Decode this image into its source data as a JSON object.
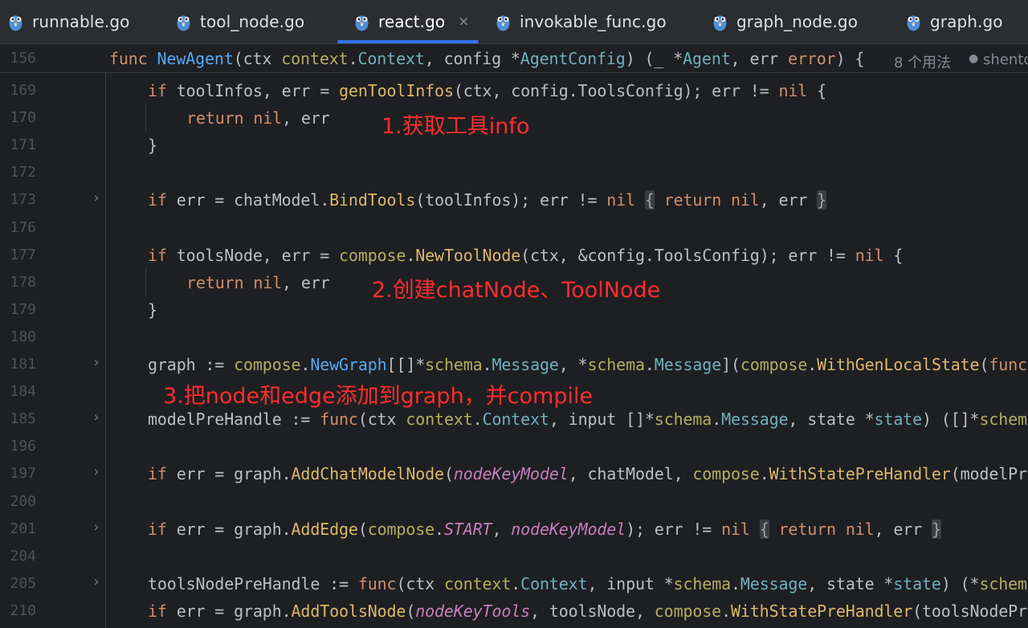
{
  "tabs": [
    {
      "label": "runnable.go",
      "icon": "gopher-icon",
      "active": false
    },
    {
      "label": "tool_node.go",
      "icon": "gopher-icon",
      "active": false
    },
    {
      "label": "react.go",
      "icon": "gopher-icon",
      "active": true,
      "close": "×"
    },
    {
      "label": "invokable_func.go",
      "icon": "gopher-icon",
      "active": false
    },
    {
      "label": "graph_node.go",
      "icon": "gopher-icon",
      "active": false
    },
    {
      "label": "graph.go",
      "icon": "gopher-icon",
      "active": false
    }
  ],
  "sticky": {
    "line_number": "156",
    "tokens": [
      {
        "t": "func ",
        "c": "kw"
      },
      {
        "t": "NewAgent",
        "c": "fn"
      },
      {
        "t": "(ctx ",
        "c": "id"
      },
      {
        "t": "context",
        "c": "pkg"
      },
      {
        "t": ".",
        "c": "id"
      },
      {
        "t": "Context",
        "c": "typ"
      },
      {
        "t": ", config *",
        "c": "id"
      },
      {
        "t": "AgentConfig",
        "c": "typ"
      },
      {
        "t": ") (_ *",
        "c": "id"
      },
      {
        "t": "Agent",
        "c": "typ"
      },
      {
        "t": ", err ",
        "c": "id"
      },
      {
        "t": "error",
        "c": "kw"
      },
      {
        "t": ") {",
        "c": "id"
      }
    ],
    "usages_hint": "8 个用法",
    "author_hint": "shentong"
  },
  "lines": [
    {
      "num": "169",
      "fold": false,
      "indent": 1,
      "tokens": [
        {
          "t": "if ",
          "c": "kw"
        },
        {
          "t": "toolInfos, err = ",
          "c": "id"
        },
        {
          "t": "genToolInfos",
          "c": "fc"
        },
        {
          "t": "(ctx, config.ToolsConfig); err != ",
          "c": "id"
        },
        {
          "t": "nil",
          "c": "kw"
        },
        {
          "t": " {",
          "c": "id"
        }
      ]
    },
    {
      "num": "170",
      "fold": false,
      "indent": 2,
      "tokens": [
        {
          "t": "return ",
          "c": "kw"
        },
        {
          "t": "nil",
          "c": "kw"
        },
        {
          "t": ", err",
          "c": "id"
        }
      ]
    },
    {
      "num": "171",
      "fold": false,
      "indent": 1,
      "tokens": [
        {
          "t": "}",
          "c": "id"
        }
      ]
    },
    {
      "num": "172",
      "fold": false,
      "indent": 1,
      "tokens": []
    },
    {
      "num": "173",
      "fold": true,
      "indent": 1,
      "tokens": [
        {
          "t": "if ",
          "c": "kw"
        },
        {
          "t": "err = chatModel.",
          "c": "id"
        },
        {
          "t": "BindTools",
          "c": "fc"
        },
        {
          "t": "(toolInfos); err != ",
          "c": "id"
        },
        {
          "t": "nil",
          "c": "kw"
        },
        {
          "t": " ",
          "c": "id"
        },
        {
          "t": "{",
          "c": "box"
        },
        {
          "t": " ",
          "c": "id"
        },
        {
          "t": "return ",
          "c": "kw"
        },
        {
          "t": "nil",
          "c": "kw"
        },
        {
          "t": ", err",
          "c": "id"
        },
        {
          "t": " ",
          "c": "id"
        },
        {
          "t": "}",
          "c": "box"
        }
      ]
    },
    {
      "num": "176",
      "fold": false,
      "indent": 1,
      "tokens": []
    },
    {
      "num": "177",
      "fold": false,
      "indent": 1,
      "tokens": [
        {
          "t": "if ",
          "c": "kw"
        },
        {
          "t": "toolsNode, err = ",
          "c": "id"
        },
        {
          "t": "compose",
          "c": "pkg"
        },
        {
          "t": ".",
          "c": "id"
        },
        {
          "t": "NewToolNode",
          "c": "fc"
        },
        {
          "t": "(ctx, &config.ToolsConfig); err != ",
          "c": "id"
        },
        {
          "t": "nil",
          "c": "kw"
        },
        {
          "t": " {",
          "c": "id"
        }
      ]
    },
    {
      "num": "178",
      "fold": false,
      "indent": 2,
      "tokens": [
        {
          "t": "return ",
          "c": "kw"
        },
        {
          "t": "nil",
          "c": "kw"
        },
        {
          "t": ", err",
          "c": "id"
        }
      ]
    },
    {
      "num": "179",
      "fold": false,
      "indent": 1,
      "tokens": [
        {
          "t": "}",
          "c": "id"
        }
      ]
    },
    {
      "num": "180",
      "fold": false,
      "indent": 1,
      "tokens": []
    },
    {
      "num": "181",
      "fold": true,
      "indent": 1,
      "tokens": [
        {
          "t": "graph := ",
          "c": "id"
        },
        {
          "t": "compose",
          "c": "pkg"
        },
        {
          "t": ".",
          "c": "id"
        },
        {
          "t": "NewGraph",
          "c": "fn"
        },
        {
          "t": "[[]*",
          "c": "id"
        },
        {
          "t": "schema",
          "c": "pkg"
        },
        {
          "t": ".",
          "c": "id"
        },
        {
          "t": "Message",
          "c": "typ"
        },
        {
          "t": ", *",
          "c": "id"
        },
        {
          "t": "schema",
          "c": "pkg"
        },
        {
          "t": ".",
          "c": "id"
        },
        {
          "t": "Message",
          "c": "typ"
        },
        {
          "t": "](",
          "c": "id"
        },
        {
          "t": "compose",
          "c": "pkg"
        },
        {
          "t": ".",
          "c": "id"
        },
        {
          "t": "WithGenLocalState",
          "c": "fc"
        },
        {
          "t": "(",
          "c": "id"
        },
        {
          "t": "func",
          "c": "kw"
        }
      ]
    },
    {
      "num": "184",
      "fold": false,
      "indent": 1,
      "tokens": []
    },
    {
      "num": "185",
      "fold": true,
      "indent": 1,
      "tokens": [
        {
          "t": "modelPreHandle := ",
          "c": "id"
        },
        {
          "t": "func",
          "c": "kw"
        },
        {
          "t": "(ctx ",
          "c": "id"
        },
        {
          "t": "context",
          "c": "pkg"
        },
        {
          "t": ".",
          "c": "id"
        },
        {
          "t": "Context",
          "c": "typ"
        },
        {
          "t": ", input []*",
          "c": "id"
        },
        {
          "t": "schema",
          "c": "pkg"
        },
        {
          "t": ".",
          "c": "id"
        },
        {
          "t": "Message",
          "c": "typ"
        },
        {
          "t": ", state *",
          "c": "id"
        },
        {
          "t": "state",
          "c": "typ"
        },
        {
          "t": ") ([]*",
          "c": "id"
        },
        {
          "t": "schema",
          "c": "pkg"
        }
      ]
    },
    {
      "num": "196",
      "fold": false,
      "indent": 1,
      "tokens": []
    },
    {
      "num": "197",
      "fold": true,
      "indent": 1,
      "tokens": [
        {
          "t": "if ",
          "c": "kw"
        },
        {
          "t": "err = graph.",
          "c": "id"
        },
        {
          "t": "AddChatModelNode",
          "c": "fc"
        },
        {
          "t": "(",
          "c": "id"
        },
        {
          "t": "nodeKeyModel",
          "c": "con"
        },
        {
          "t": ", chatModel, ",
          "c": "id"
        },
        {
          "t": "compose",
          "c": "pkg"
        },
        {
          "t": ".",
          "c": "id"
        },
        {
          "t": "WithStatePreHandler",
          "c": "fc"
        },
        {
          "t": "(modelPreHandle",
          "c": "id"
        }
      ]
    },
    {
      "num": "200",
      "fold": false,
      "indent": 1,
      "tokens": []
    },
    {
      "num": "201",
      "fold": true,
      "indent": 1,
      "tokens": [
        {
          "t": "if ",
          "c": "kw"
        },
        {
          "t": "err = graph.",
          "c": "id"
        },
        {
          "t": "AddEdge",
          "c": "fc"
        },
        {
          "t": "(",
          "c": "id"
        },
        {
          "t": "compose",
          "c": "pkg"
        },
        {
          "t": ".",
          "c": "id"
        },
        {
          "t": "START",
          "c": "con"
        },
        {
          "t": ", ",
          "c": "id"
        },
        {
          "t": "nodeKeyModel",
          "c": "con"
        },
        {
          "t": "); err != ",
          "c": "id"
        },
        {
          "t": "nil",
          "c": "kw"
        },
        {
          "t": " ",
          "c": "id"
        },
        {
          "t": "{",
          "c": "box"
        },
        {
          "t": " ",
          "c": "id"
        },
        {
          "t": "return ",
          "c": "kw"
        },
        {
          "t": "nil",
          "c": "kw"
        },
        {
          "t": ", err",
          "c": "id"
        },
        {
          "t": " ",
          "c": "id"
        },
        {
          "t": "}",
          "c": "box"
        }
      ]
    },
    {
      "num": "204",
      "fold": false,
      "indent": 1,
      "tokens": []
    },
    {
      "num": "205",
      "fold": true,
      "indent": 1,
      "tokens": [
        {
          "t": "toolsNodePreHandle := ",
          "c": "id"
        },
        {
          "t": "func",
          "c": "kw"
        },
        {
          "t": "(ctx ",
          "c": "id"
        },
        {
          "t": "context",
          "c": "pkg"
        },
        {
          "t": ".",
          "c": "id"
        },
        {
          "t": "Context",
          "c": "typ"
        },
        {
          "t": ", input *",
          "c": "id"
        },
        {
          "t": "schema",
          "c": "pkg"
        },
        {
          "t": ".",
          "c": "id"
        },
        {
          "t": "Message",
          "c": "typ"
        },
        {
          "t": ", state *",
          "c": "id"
        },
        {
          "t": "state",
          "c": "typ"
        },
        {
          "t": ") (*",
          "c": "id"
        },
        {
          "t": "schema",
          "c": "pkg"
        }
      ]
    },
    {
      "num": "210",
      "fold": false,
      "indent": 1,
      "tokens": [
        {
          "t": "if ",
          "c": "kw"
        },
        {
          "t": "err = graph.",
          "c": "id"
        },
        {
          "t": "AddToolsNode",
          "c": "fc"
        },
        {
          "t": "(",
          "c": "id"
        },
        {
          "t": "nodeKeyTools",
          "c": "con"
        },
        {
          "t": ", toolsNode, ",
          "c": "id"
        },
        {
          "t": "compose",
          "c": "pkg"
        },
        {
          "t": ".",
          "c": "id"
        },
        {
          "t": "WithStatePreHandler",
          "c": "fc"
        },
        {
          "t": "(toolsNodePreHandle",
          "c": "id"
        }
      ]
    }
  ],
  "annotations": [
    {
      "text": "1.获取工具info"
    },
    {
      "text": "2.创建chatNode、ToolNode"
    },
    {
      "text": "3.把node和edge添加到graph，并compile"
    }
  ],
  "colors": {
    "background": "#1e1f22",
    "tabbar": "#2b2d30",
    "accent": "#3574f0",
    "annotation": "#ff2d2d"
  }
}
